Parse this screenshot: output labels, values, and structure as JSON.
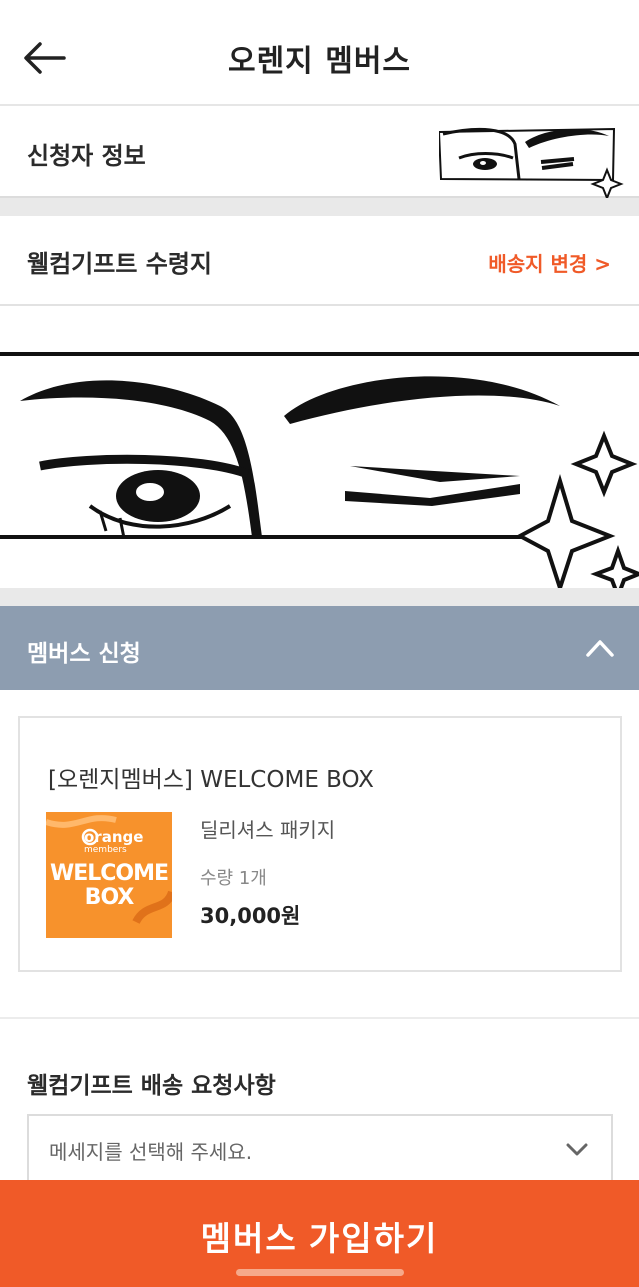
{
  "header": {
    "title": "오렌지 멤버스",
    "back_icon": "arrow-left-icon"
  },
  "applicant": {
    "label": "신청자 정보"
  },
  "gift_address": {
    "label": "웰컴기프트 수령지",
    "change_label": "배송지 변경 >"
  },
  "membership": {
    "section_title": "멤버스 신청",
    "toggle_icon": "chevron-up-icon"
  },
  "product": {
    "title": "[오렌지멤버스] WELCOME BOX",
    "thumb_brand": "orange",
    "thumb_sub": "members",
    "thumb_title": "WELCOME BOX",
    "name": "딜리셔스 패키지",
    "quantity": "수량 1개",
    "price": "30,000원"
  },
  "request": {
    "title": "웰컴기프트 배송 요청사항",
    "placeholder": "메세지를 선택해 주세요.",
    "dropdown_icon": "chevron-down-icon"
  },
  "cta": {
    "label": "멤버스 가입하기"
  },
  "colors": {
    "accent": "#f05a28",
    "accordion": "#8d9db0",
    "thumb": "#f7922c"
  }
}
